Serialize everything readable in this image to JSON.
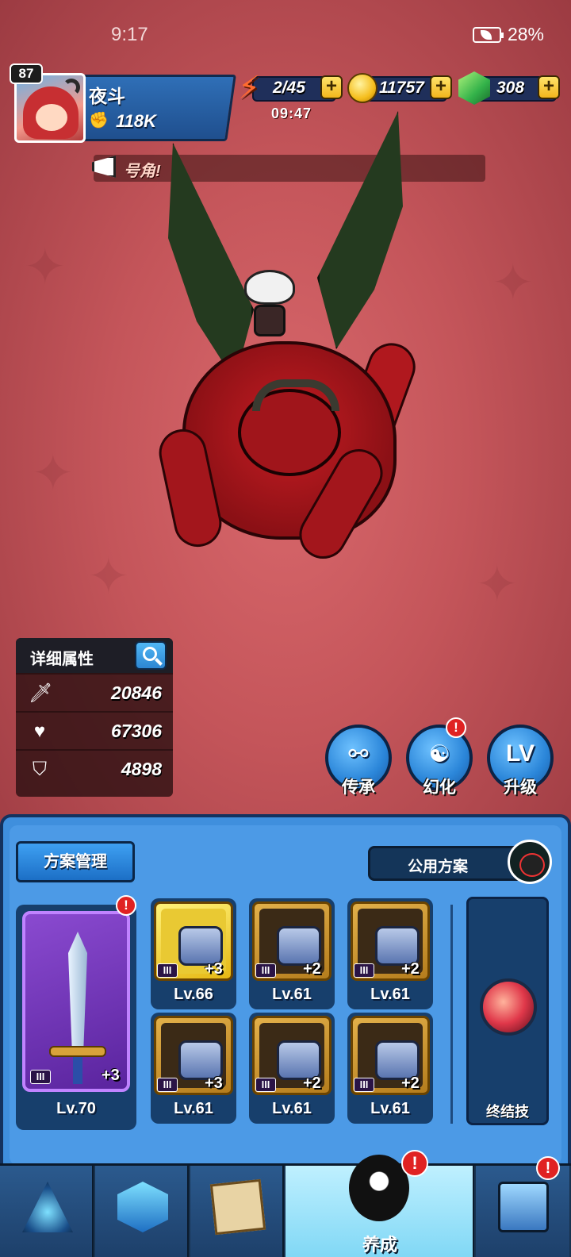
{
  "status_bar": {
    "time": "9:17",
    "battery": "28%"
  },
  "player": {
    "level": "87",
    "name": "夜斗",
    "power": "118K"
  },
  "resources": {
    "energy": "2/45",
    "energy_timer": "09:47",
    "coins": "11757",
    "gems": "308",
    "plus_label": "+"
  },
  "announcement": {
    "text": "号角!"
  },
  "stats": {
    "title": "详细属性",
    "rows": [
      {
        "icon": "attack-icon",
        "value": "20846"
      },
      {
        "icon": "health-icon",
        "value": "67306"
      },
      {
        "icon": "defense-icon",
        "value": "4898"
      }
    ]
  },
  "actions": {
    "inherit": {
      "label": "传承"
    },
    "transform": {
      "label": "幻化",
      "badge": "!"
    },
    "upgrade": {
      "label": "升级",
      "glyph": "LV"
    }
  },
  "equipment": {
    "plan_button": "方案管理",
    "public_plan": "公用方案",
    "weapon": {
      "tier": "III",
      "enhance": "+3",
      "level": "Lv.70",
      "badge": "!"
    },
    "slots": [
      {
        "tier": "III",
        "enhance": "+3",
        "level": "Lv.66"
      },
      {
        "tier": "III",
        "enhance": "+2",
        "level": "Lv.61"
      },
      {
        "tier": "III",
        "enhance": "+2",
        "level": "Lv.61"
      },
      {
        "tier": "III",
        "enhance": "+3",
        "level": "Lv.61"
      },
      {
        "tier": "III",
        "enhance": "+2",
        "level": "Lv.61"
      },
      {
        "tier": "III",
        "enhance": "+2",
        "level": "Lv.61"
      }
    ],
    "ultimate_label": "终结技"
  },
  "nav": {
    "items": [
      {
        "icon": "dungeon-icon"
      },
      {
        "icon": "crystal-icon"
      },
      {
        "icon": "map-icon"
      },
      {
        "icon": "character-icon",
        "label": "养成",
        "badge": "!"
      },
      {
        "icon": "shop-icon",
        "badge": "!"
      }
    ]
  },
  "colors": {
    "background": "#c4555a",
    "panel_blue": "#3f8fdd",
    "gold": "#f2b61c",
    "alert_red": "#e02222"
  }
}
